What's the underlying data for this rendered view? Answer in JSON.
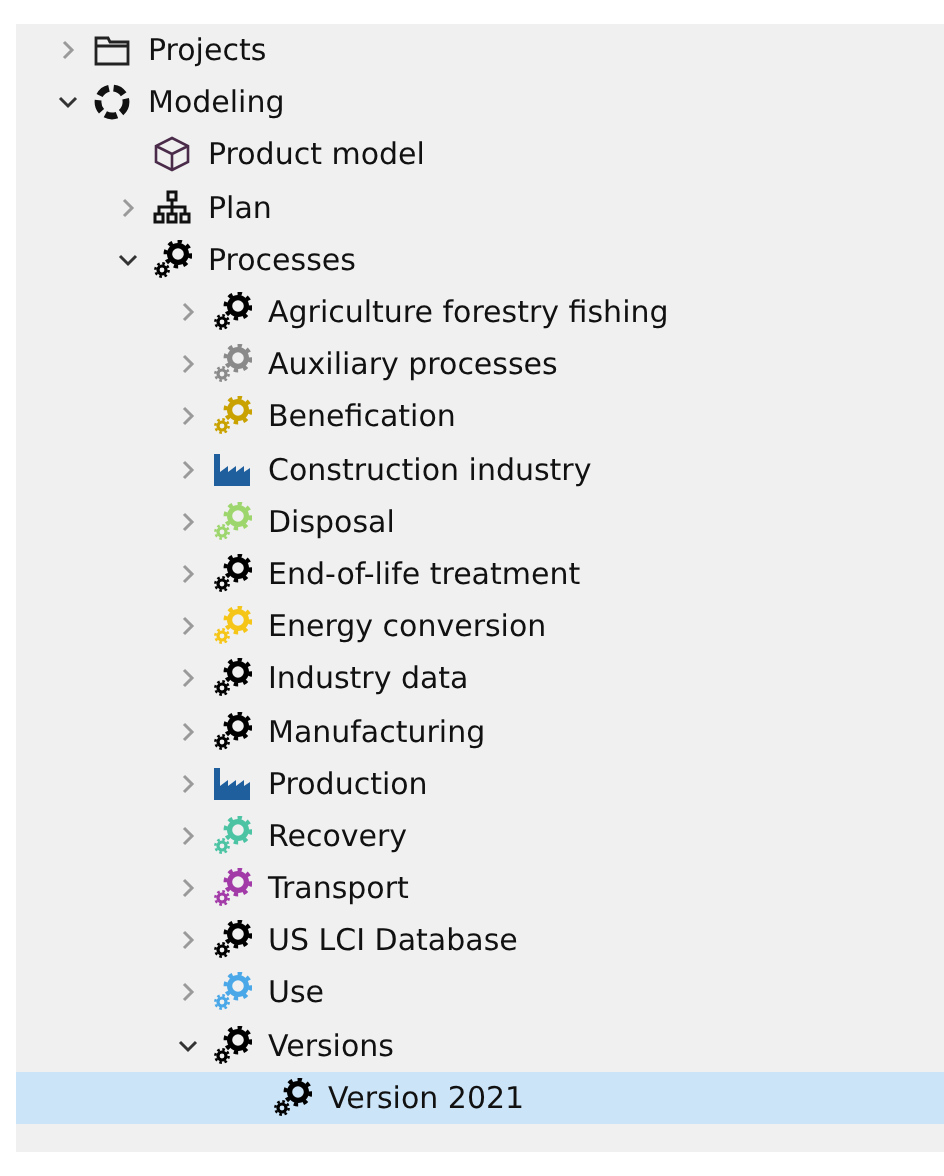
{
  "tree": [
    {
      "label": "Projects",
      "kind": "folder",
      "expanded": false,
      "selected": false
    },
    {
      "label": "Modeling",
      "kind": "ring",
      "expanded": true,
      "selected": false,
      "children": [
        {
          "label": "Product model",
          "kind": "cube",
          "selected": false
        },
        {
          "label": "Plan",
          "kind": "hierarchy",
          "expanded": false,
          "selected": false
        },
        {
          "label": "Processes",
          "kind": "gears",
          "color": "#000000",
          "expanded": true,
          "selected": false,
          "children": [
            {
              "label": "Agriculture forestry fishing",
              "kind": "gears",
              "color": "#000000",
              "expanded": false,
              "selected": false
            },
            {
              "label": "Auxiliary processes",
              "kind": "gears",
              "color": "#8a8a8a",
              "expanded": false,
              "selected": false
            },
            {
              "label": "Benefication",
              "kind": "gears",
              "color": "#c9a200",
              "expanded": false,
              "selected": false
            },
            {
              "label": "Construction industry",
              "kind": "factory",
              "color": "#1f5f9e",
              "expanded": false,
              "selected": false
            },
            {
              "label": "Disposal",
              "kind": "gears",
              "color": "#9ed66e",
              "expanded": false,
              "selected": false
            },
            {
              "label": "End-of-life treatment",
              "kind": "gears",
              "color": "#000000",
              "expanded": false,
              "selected": false
            },
            {
              "label": "Energy conversion",
              "kind": "gears",
              "color": "#f5c518",
              "expanded": false,
              "selected": false
            },
            {
              "label": "Industry data",
              "kind": "gears",
              "color": "#000000",
              "expanded": false,
              "selected": false
            },
            {
              "label": "Manufacturing",
              "kind": "gears",
              "color": "#000000",
              "expanded": false,
              "selected": false
            },
            {
              "label": "Production",
              "kind": "factory",
              "color": "#1f5f9e",
              "expanded": false,
              "selected": false
            },
            {
              "label": "Recovery",
              "kind": "gears",
              "color": "#4cc4a4",
              "expanded": false,
              "selected": false
            },
            {
              "label": "Transport",
              "kind": "gears",
              "color": "#a23aa8",
              "expanded": false,
              "selected": false
            },
            {
              "label": "US LCI Database",
              "kind": "gears",
              "color": "#000000",
              "expanded": false,
              "selected": false
            },
            {
              "label": "Use",
              "kind": "gears",
              "color": "#4aa8e8",
              "expanded": false,
              "selected": false
            },
            {
              "label": "Versions",
              "kind": "gears",
              "color": "#000000",
              "expanded": true,
              "selected": false,
              "children": [
                {
                  "label": "Version 2021",
                  "kind": "gears",
                  "color": "#000000",
                  "selected": true
                }
              ]
            }
          ]
        }
      ]
    }
  ]
}
